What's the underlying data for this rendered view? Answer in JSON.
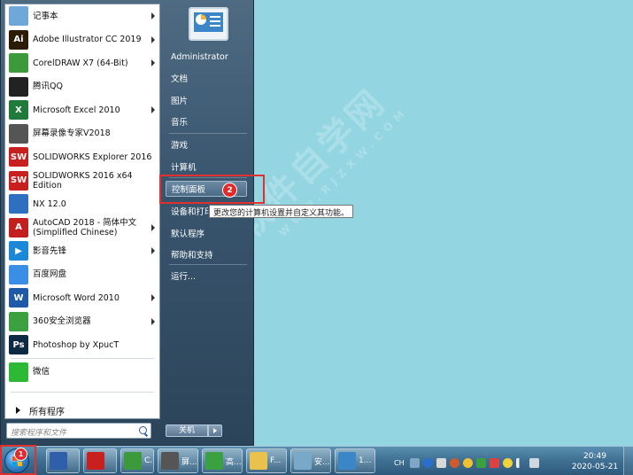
{
  "watermark": {
    "main": "软件自学网",
    "sub": "WWW.RJZXW.COM"
  },
  "start_menu": {
    "apps": [
      {
        "label": "记事本",
        "icon": "notepad-icon",
        "color": "#6fa8d8",
        "arrow": true
      },
      {
        "label": "Adobe Illustrator CC 2019",
        "icon": "illustrator-icon",
        "color": "#2b1b07",
        "glyph": "Ai",
        "arrow": true
      },
      {
        "label": "CorelDRAW X7 (64-Bit)",
        "icon": "coreldraw-icon",
        "color": "#3c9a3c",
        "arrow": true
      },
      {
        "label": "腾讯QQ",
        "icon": "qq-penguin-icon",
        "color": "#222222",
        "arrow": false
      },
      {
        "label": "Microsoft Excel 2010",
        "icon": "excel-icon",
        "color": "#1f7a3b",
        "glyph": "X",
        "arrow": true
      },
      {
        "label": "屏幕录像专家V2018",
        "icon": "screen-recorder-icon",
        "color": "#555555",
        "arrow": false
      },
      {
        "label": "SOLIDWORKS Explorer 2016",
        "icon": "solidworks-explorer-icon",
        "color": "#c8201e",
        "glyph": "SW",
        "arrow": false
      },
      {
        "label": "SOLIDWORKS 2016 x64 Edition",
        "icon": "solidworks-icon",
        "color": "#c8201e",
        "glyph": "SW",
        "arrow": false
      },
      {
        "label": "NX 12.0",
        "icon": "nx-icon",
        "color": "#2f6fbf",
        "arrow": false
      },
      {
        "label": "AutoCAD 2018 - 简体中文 (Simplified Chinese)",
        "icon": "autocad-icon",
        "color": "#c22020",
        "glyph": "A",
        "arrow": true
      },
      {
        "label": "影音先锋",
        "icon": "media-player-icon",
        "color": "#1e88d8",
        "glyph": "▶",
        "arrow": true
      },
      {
        "label": "百度网盘",
        "icon": "baidu-netdisk-icon",
        "color": "#3a8ee6",
        "arrow": false
      },
      {
        "label": "Microsoft Word 2010",
        "icon": "word-icon",
        "color": "#1e5aa8",
        "glyph": "W",
        "arrow": true
      },
      {
        "label": "360安全浏览器",
        "icon": "360-browser-icon",
        "color": "#3aa040",
        "arrow": true
      },
      {
        "label": "Photoshop by XpucT",
        "icon": "photoshop-icon",
        "color": "#0d2a45",
        "glyph": "Ps",
        "arrow": false
      },
      {
        "label": "微信",
        "icon": "wechat-icon",
        "color": "#2db935",
        "arrow": false
      }
    ],
    "all_programs": "所有程序",
    "search_placeholder": "搜索程序和文件",
    "right": {
      "user": "Administrator",
      "documents": "文档",
      "pictures": "图片",
      "music": "音乐",
      "games": "游戏",
      "computer": "计算机",
      "control_panel": "控制面板",
      "devices": "设备和打印",
      "default_programs": "默认程序",
      "help": "帮助和支持",
      "run": "运行..."
    },
    "tooltip": "更改您的计算机设置并自定义其功能。",
    "shutdown": "关机",
    "badge_start": "1",
    "badge_control": "2"
  },
  "taskbar": {
    "buttons": [
      {
        "label": "",
        "icon": "paint-brush-icon"
      },
      {
        "label": "",
        "icon": "solidworks-taskbar-icon"
      },
      {
        "label": "C...",
        "icon": "coreldraw-taskbar-icon"
      },
      {
        "label": "屏...",
        "icon": "screen-recorder-taskbar-icon"
      },
      {
        "label": "高...",
        "icon": "360-browser-taskbar-icon"
      },
      {
        "label": "F...",
        "icon": "folder-icon"
      },
      {
        "label": "安...",
        "icon": "installer-icon"
      },
      {
        "label": "1...",
        "icon": "image-viewer-icon"
      }
    ],
    "tray_lang": "CH",
    "time": "20:49",
    "date": "2020-05-21"
  }
}
